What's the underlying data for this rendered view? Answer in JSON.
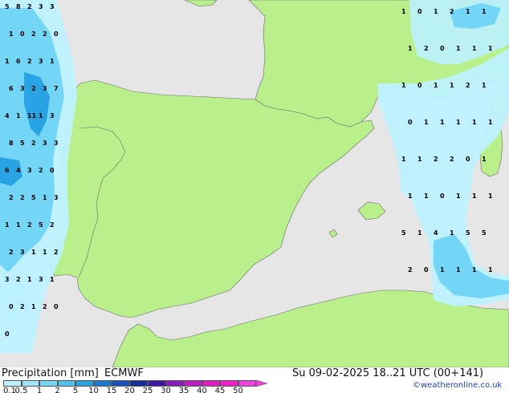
{
  "title": "Precipitation [mm]",
  "model": "ECMWF",
  "datetime": "Su 09-02-2025 18..21 UTC (00+141)",
  "credit": "©weatheronline.co.uk",
  "colorbar": {
    "tick_labels": [
      "0.1",
      "0.5",
      "1",
      "2",
      "5",
      "10",
      "15",
      "20",
      "25",
      "30",
      "35",
      "40",
      "45",
      "50"
    ],
    "colors": [
      "#bdf1ff",
      "#9be6fb",
      "#73d6f6",
      "#4ec1ee",
      "#2aa3e4",
      "#1a7bd3",
      "#1751bc",
      "#12309e",
      "#3d16a7",
      "#8a19bd",
      "#c21cc7",
      "#e21bc8",
      "#f51ecf",
      "#f53ee0"
    ]
  },
  "colors": {
    "sea": "#e6e6e6",
    "land": "#b9f08c",
    "border": "#6a6a6a",
    "precip_light": "#bdf1ff",
    "precip_medium": "#73d6f6",
    "precip_heavy": "#2aa3e4"
  },
  "precip_labels": {
    "atlantic": [
      "5",
      "8",
      "2",
      "3",
      "3",
      "1",
      "0",
      "2",
      "2",
      "0",
      "1",
      "6",
      "2",
      "3",
      "1",
      "6",
      "3",
      "2",
      "3",
      "7",
      "4",
      "1",
      "11",
      "1",
      "3",
      "8",
      "5",
      "2",
      "3",
      "3",
      "6",
      "4",
      "3",
      "2",
      "0",
      "2",
      "2",
      "5",
      "1",
      "3",
      "1",
      "1",
      "2",
      "5",
      "2",
      "2",
      "3",
      "1",
      "1",
      "2",
      "3",
      "2",
      "1",
      "3",
      "1",
      "0",
      "2",
      "1",
      "2",
      "0",
      "0"
    ],
    "mediterranean": [
      "1",
      "0",
      "1",
      "2",
      "1",
      "1",
      "1",
      "2",
      "0",
      "1",
      "1",
      "1",
      "1",
      "0",
      "1",
      "1",
      "2",
      "1",
      "0",
      "1",
      "1",
      "1",
      "1",
      "1",
      "1",
      "1",
      "2",
      "2",
      "0",
      "1",
      "1",
      "1",
      "0",
      "1",
      "1",
      "1",
      "5",
      "1",
      "4",
      "1",
      "5",
      "5",
      "2",
      "0",
      "1",
      "1",
      "1",
      "1"
    ]
  }
}
